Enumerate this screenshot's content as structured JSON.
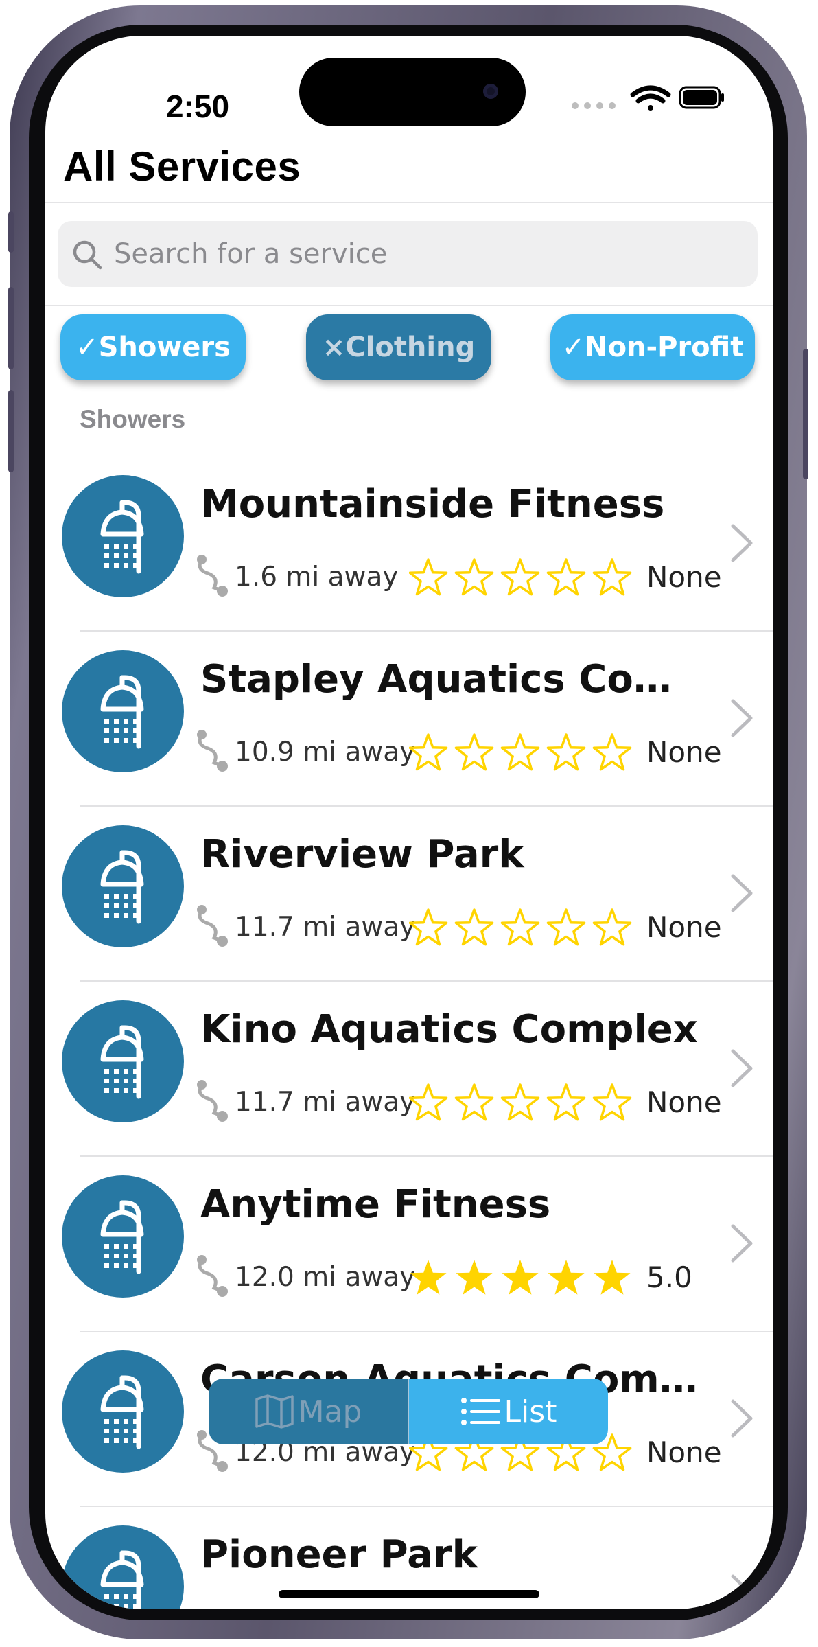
{
  "status_bar": {
    "time": "2:50"
  },
  "header": {
    "title": "All Services"
  },
  "search": {
    "placeholder": "Search for a service"
  },
  "filters": [
    {
      "label": "✓Showers",
      "active": true
    },
    {
      "label": "×Clothing",
      "active": false
    },
    {
      "label": "✓Non-Profit",
      "active": true
    }
  ],
  "section": {
    "title": "Showers"
  },
  "services": [
    {
      "name": "Mountainside Fitness",
      "distance": "1.6 mi away",
      "rating": "None",
      "stars": 0
    },
    {
      "name": "Stapley Aquatics Compl...",
      "distance": "10.9 mi away",
      "rating": "None",
      "stars": 0
    },
    {
      "name": "Riverview Park",
      "distance": "11.7 mi away",
      "rating": "None",
      "stars": 0
    },
    {
      "name": "Kino Aquatics Complex",
      "distance": "11.7 mi away",
      "rating": "None",
      "stars": 0
    },
    {
      "name": "Anytime Fitness",
      "distance": "12.0 mi away",
      "rating": "5.0",
      "stars": 5
    },
    {
      "name": "Carson Aquatics Compl...",
      "distance": "12.0 mi away",
      "rating": "None",
      "stars": 0
    },
    {
      "name": "Pioneer Park",
      "distance": "",
      "rating": "",
      "stars": 0
    }
  ],
  "view_toggle": {
    "map_label": "Map",
    "list_label": "List",
    "selected": "List"
  },
  "colors": {
    "accent_active": "#3bb3ee",
    "accent_inactive": "#2b7aa5",
    "icon_circle": "#2778a3",
    "star": "#ffd400"
  }
}
